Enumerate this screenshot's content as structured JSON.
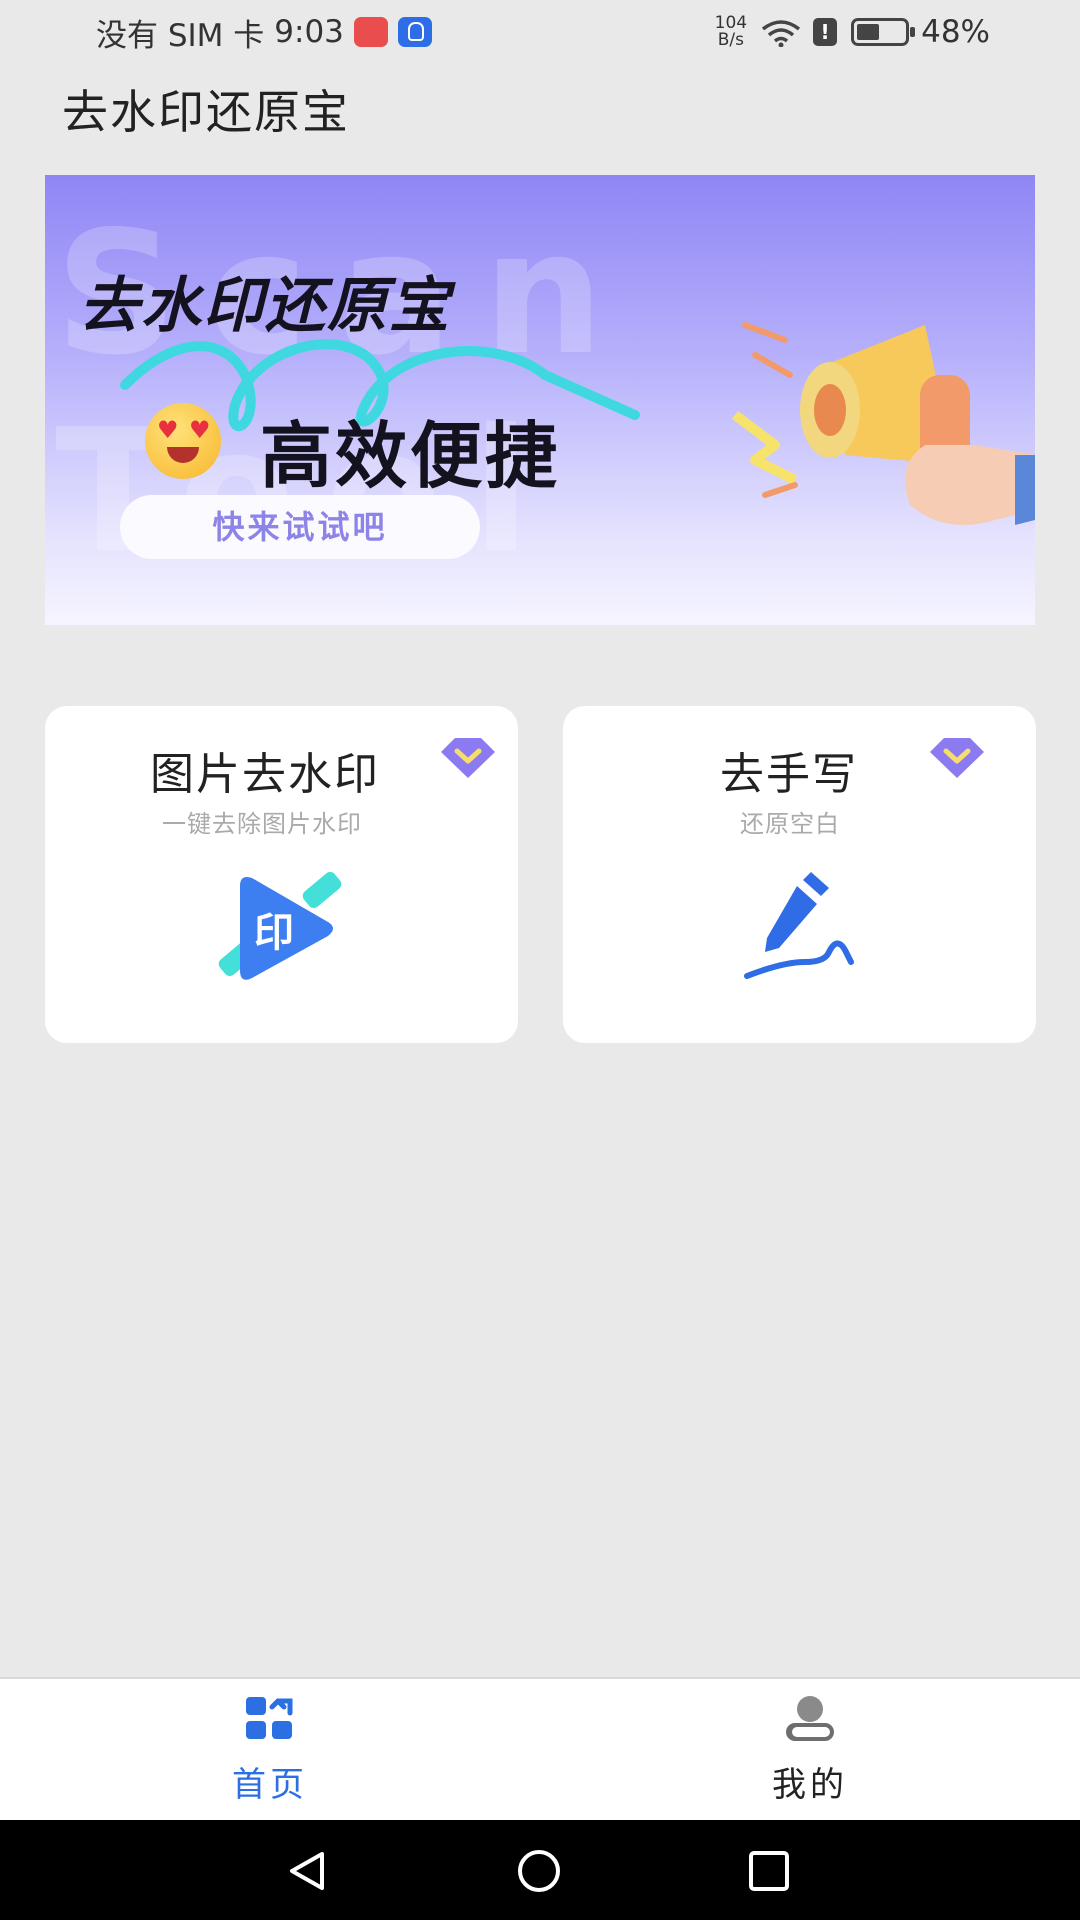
{
  "status_bar": {
    "carrier": "没有 SIM 卡",
    "time": "9:03",
    "speed_value": "104",
    "speed_unit": "B/s",
    "battery": "48%",
    "icons": [
      "huawei-app-icon",
      "bulb-app-icon",
      "wifi-icon",
      "alert-icon",
      "battery-icon"
    ]
  },
  "app": {
    "title": "去水印还原宝"
  },
  "banner": {
    "bg_text": "Scan Tool",
    "headline": "去水印还原宝",
    "subheadline": "高效便捷",
    "cta": "快来试试吧",
    "colors": {
      "top": "#8f86f5",
      "bottom": "#f6f5ff",
      "cta_text": "#8d84e8"
    }
  },
  "features": [
    {
      "title": "图片去水印",
      "subtitle": "一键去除图片水印",
      "icon": "watermark-icon",
      "badge_icon": "vip-icon"
    },
    {
      "title": "去手写",
      "subtitle": "还原空白",
      "icon": "pen-icon",
      "badge_icon": "vip-icon"
    }
  ],
  "tabs": [
    {
      "label": "首页",
      "icon": "home-grid-icon",
      "active": true
    },
    {
      "label": "我的",
      "icon": "profile-icon",
      "active": false
    }
  ],
  "theme": {
    "accent": "#2b6fe3",
    "vip": "#8c7bf0",
    "background": "#e9e9ea"
  }
}
